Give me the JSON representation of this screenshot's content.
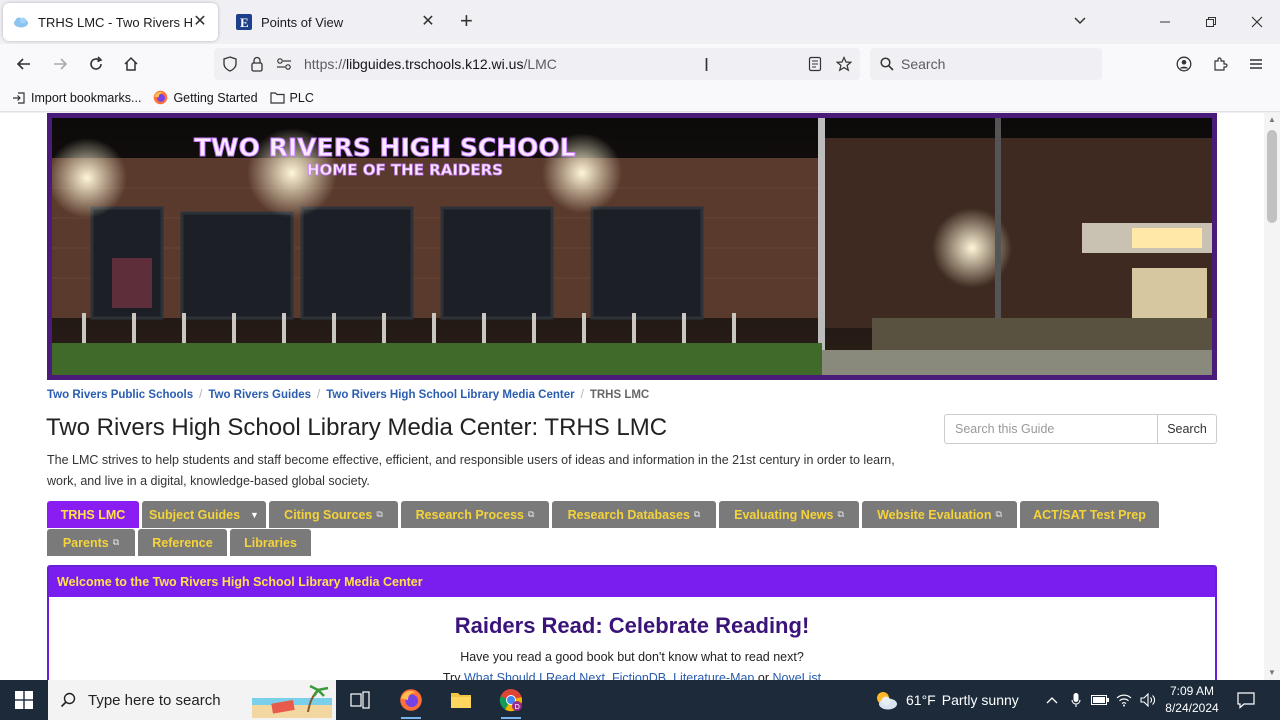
{
  "browser": {
    "tabs": [
      {
        "title": "TRHS LMC - Two Rivers High Sc",
        "active": true
      },
      {
        "title": "Points of View",
        "active": false
      }
    ],
    "url": {
      "host": "libguides.trschools.k12.wi.us",
      "prefix": "https://",
      "path": "/LMC"
    },
    "search_placeholder": "Search",
    "bookmarks": [
      {
        "label": "Import bookmarks...",
        "icon": "import-icon"
      },
      {
        "label": "Getting Started",
        "icon": "firefox-icon"
      },
      {
        "label": "PLC",
        "icon": "folder-icon"
      }
    ]
  },
  "page": {
    "banner": {
      "line1": "TWO RIVERS HIGH SCHOOL",
      "line2": "HOME OF THE RAIDERS"
    },
    "breadcrumb": [
      "Two Rivers Public Schools",
      "Two Rivers Guides",
      "Two Rivers High School Library Media Center",
      "TRHS LMC"
    ],
    "title": "Two Rivers High School Library Media Center: TRHS LMC",
    "description": "The LMC strives to help students and staff become effective, efficient, and responsible users of ideas and information in the 21st century in order to learn, work, and live in a digital, knowledge-based global society.",
    "guide_search": {
      "placeholder": "Search this Guide",
      "button": "Search"
    },
    "nav_tabs": [
      {
        "label": "TRHS LMC"
      },
      {
        "label": "Subject Guides"
      },
      {
        "label": "Citing Sources"
      },
      {
        "label": "Research Process"
      },
      {
        "label": "Research Databases"
      },
      {
        "label": "Evaluating News"
      },
      {
        "label": "Website Evaluation"
      },
      {
        "label": "ACT/SAT Test Prep"
      },
      {
        "label": "Parents"
      },
      {
        "label": "Reference"
      },
      {
        "label": "Libraries"
      }
    ],
    "welcome": {
      "header": "Welcome to the Two Rivers High School Library Media Center",
      "heading": "Raiders Read: Celebrate Reading!",
      "question": "Have you read a good book but don't know what to read next?",
      "try_prefix": "Try",
      "links": [
        "What Should I Read Next",
        "FictionDB",
        "Literature-Map"
      ],
      "or": "or",
      "last_link": "NoveList"
    }
  },
  "taskbar": {
    "search_placeholder": "Type here to search",
    "weather": {
      "temp": "61°F",
      "condition": "Partly sunny"
    },
    "time": "7:09 AM",
    "date": "8/24/2024"
  },
  "colors": {
    "accent_purple": "#7a1ef0",
    "tab_gray": "#7a7a7a",
    "tab_text_yellow": "#f5d33a",
    "link_blue": "#2a5db0"
  }
}
